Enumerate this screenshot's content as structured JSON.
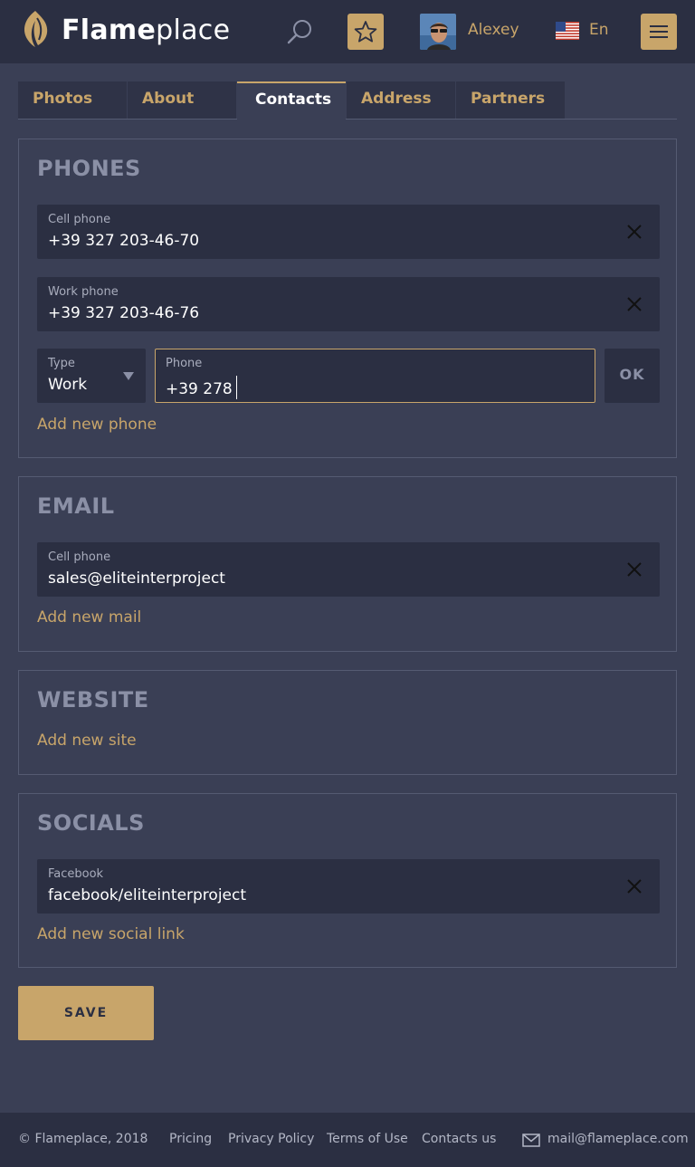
{
  "header": {
    "brand_bold": "Flame",
    "brand_light": "place",
    "username": "Alexey",
    "language": "En"
  },
  "tabs": [
    {
      "label": "Photos",
      "active": false
    },
    {
      "label": "About",
      "active": false
    },
    {
      "label": "Contacts",
      "active": true
    },
    {
      "label": "Address",
      "active": false
    },
    {
      "label": "Partners",
      "active": false
    }
  ],
  "phones": {
    "title": "PHONES",
    "entries": [
      {
        "label": "Cell phone",
        "value": "+39 327 203-46-70"
      },
      {
        "label": "Work phone",
        "value": "+39 327 203-46-76"
      }
    ],
    "new_entry": {
      "type_label": "Type",
      "type_value": "Work",
      "phone_label": "Phone",
      "phone_value": "+39 278",
      "ok_label": "OK"
    },
    "add_link": "Add new phone"
  },
  "email": {
    "title": "EMAIL",
    "entries": [
      {
        "label": "Cell phone",
        "value": "sales@eliteinterproject"
      }
    ],
    "add_link": "Add new mail"
  },
  "website": {
    "title": "WEBSITE",
    "add_link": "Add new site"
  },
  "socials": {
    "title": "SOCIALS",
    "entries": [
      {
        "label": "Facebook",
        "value": "facebook/eliteinterproject"
      }
    ],
    "add_link": "Add new social link"
  },
  "save_label": "SAVE",
  "footer": {
    "copyright": "© Flameplace, 2018",
    "links": [
      "Pricing",
      "Privacy Policy",
      "Terms of Use",
      "Contacts us"
    ],
    "email": "mail@flameplace.com"
  },
  "colors": {
    "accent": "#c8a56a",
    "background": "#3a3f55",
    "header": "#2b2f42",
    "field": "#2b2f42",
    "muted_title": "#8b90a6"
  },
  "icons": [
    "flame-logo-icon",
    "search-icon",
    "star-icon",
    "us-flag-icon",
    "hamburger-menu-icon",
    "close-icon",
    "dropdown-arrow-icon",
    "mail-icon"
  ]
}
